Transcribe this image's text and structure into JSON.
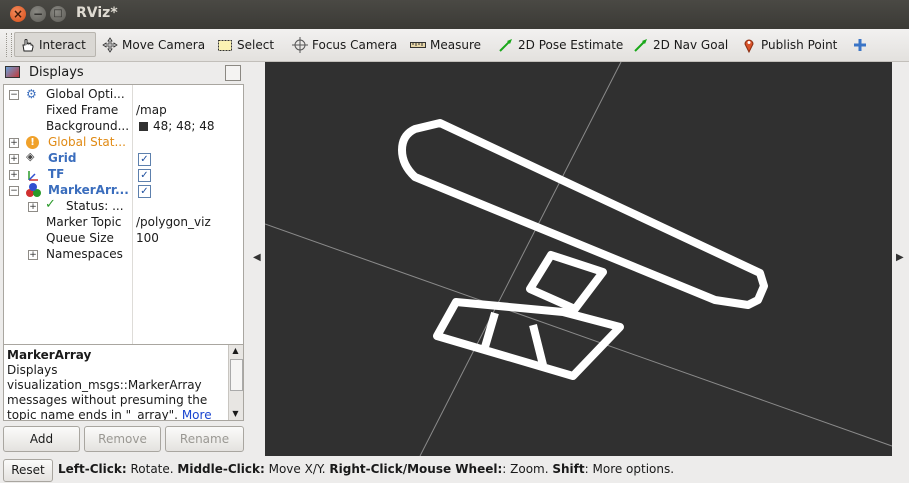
{
  "window": {
    "title": "RViz*"
  },
  "toolbar": {
    "interact": "Interact",
    "move_camera": "Move Camera",
    "select": "Select",
    "focus_camera": "Focus Camera",
    "measure": "Measure",
    "pose_estimate": "2D Pose Estimate",
    "nav_goal": "2D Nav Goal",
    "publish_point": "Publish Point"
  },
  "displays": {
    "title": "Displays",
    "global_options": "Global Opti...",
    "fixed_frame_label": "Fixed Frame",
    "fixed_frame_value": "/map",
    "background_label": "Background...",
    "background_value": "48; 48; 48",
    "background_color": "#303030",
    "global_status": "Global Stat...",
    "grid": "Grid",
    "tf": "TF",
    "marker_array": "MarkerArr...",
    "status": "Status: ...",
    "marker_topic_label": "Marker Topic",
    "marker_topic_value": "/polygon_viz",
    "queue_size_label": "Queue Size",
    "queue_size_value": "100",
    "namespaces": "Namespaces"
  },
  "description": {
    "title": "MarkerArray",
    "text": "Displays visualization_msgs::MarkerArray messages without presuming the topic name ends in \"_array\".",
    "more": "More"
  },
  "buttons": {
    "add": "Add",
    "remove": "Remove",
    "rename": "Rename"
  },
  "statusbar": {
    "reset": "Reset",
    "h1": "Left-Click:",
    "t1": " Rotate. ",
    "h2": "Middle-Click:",
    "t2": " Move X/Y. ",
    "h3": "Right-Click/Mouse Wheel:",
    "t3": ": Zoom. ",
    "h4": "Shift",
    "t4": ": More options."
  }
}
